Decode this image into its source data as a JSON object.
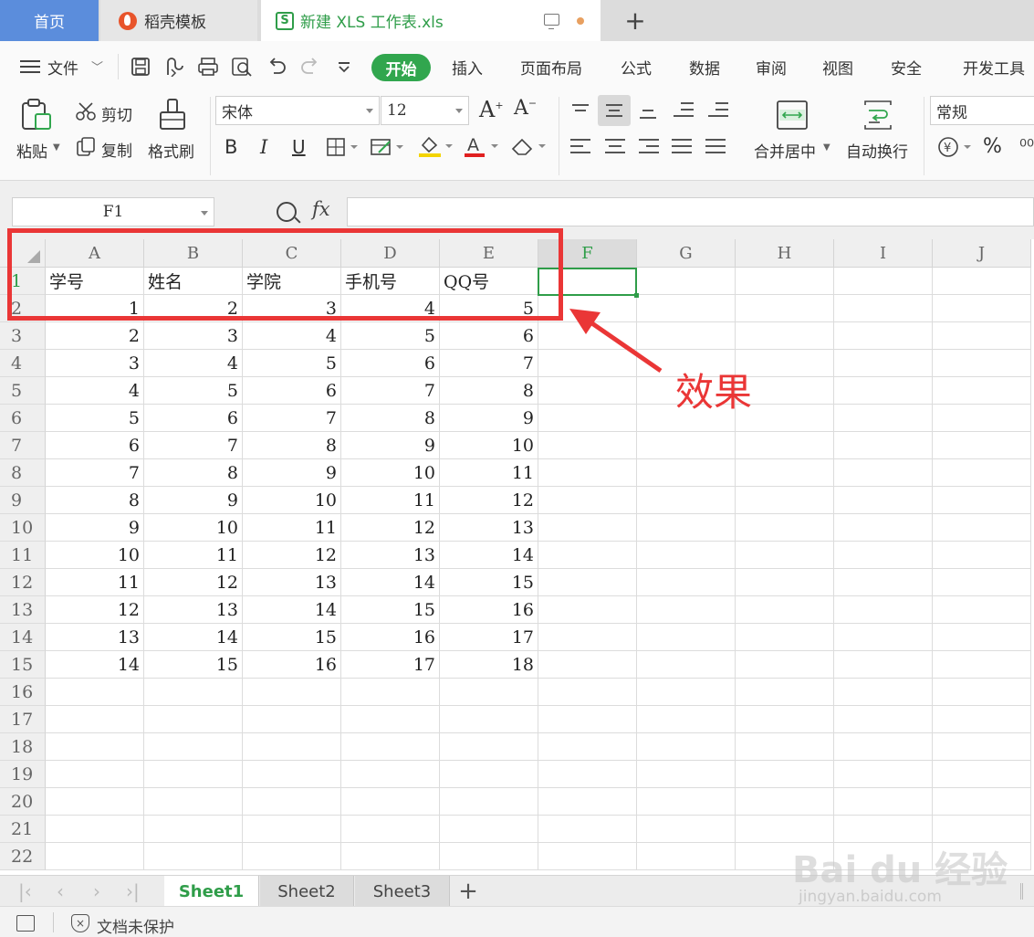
{
  "tabs": {
    "home": "首页",
    "daoke": "稻壳模板",
    "file": "新建 XLS 工作表.xls",
    "file_logo": "S"
  },
  "menu": {
    "file": "文件",
    "items": [
      "开始",
      "插入",
      "页面布局",
      "公式",
      "数据",
      "审阅",
      "视图",
      "安全",
      "开发工具"
    ]
  },
  "ribbon": {
    "paste": "粘贴",
    "cut": "剪切",
    "copy": "复制",
    "format_painter": "格式刷",
    "font_name": "宋体",
    "font_size": "12",
    "bold": "B",
    "italic": "I",
    "underline": "U",
    "merge_center": "合并居中",
    "wrap_text": "自动换行",
    "number_format": "常规",
    "percent": "%"
  },
  "formula_bar": {
    "name_box": "F1",
    "fx": "fx",
    "formula": ""
  },
  "grid": {
    "columns": [
      "A",
      "B",
      "C",
      "D",
      "E",
      "F",
      "G",
      "H",
      "I",
      "J"
    ],
    "active_column": "F",
    "active_row": "1",
    "row_numbers": [
      "1",
      "2",
      "3",
      "4",
      "5",
      "6",
      "7",
      "8",
      "9",
      "10",
      "11",
      "12",
      "13",
      "14",
      "15",
      "16",
      "17",
      "18",
      "19",
      "20",
      "21",
      "22"
    ],
    "header_row": [
      "学号",
      "姓名",
      "学院",
      "手机号",
      "QQ号"
    ],
    "rows": [
      [
        "1",
        "2",
        "3",
        "4",
        "5"
      ],
      [
        "2",
        "3",
        "4",
        "5",
        "6"
      ],
      [
        "3",
        "4",
        "5",
        "6",
        "7"
      ],
      [
        "4",
        "5",
        "6",
        "7",
        "8"
      ],
      [
        "5",
        "6",
        "7",
        "8",
        "9"
      ],
      [
        "6",
        "7",
        "8",
        "9",
        "10"
      ],
      [
        "7",
        "8",
        "9",
        "10",
        "11"
      ],
      [
        "8",
        "9",
        "10",
        "11",
        "12"
      ],
      [
        "9",
        "10",
        "11",
        "12",
        "13"
      ],
      [
        "10",
        "11",
        "12",
        "13",
        "14"
      ],
      [
        "11",
        "12",
        "13",
        "14",
        "15"
      ],
      [
        "12",
        "13",
        "14",
        "15",
        "16"
      ],
      [
        "13",
        "14",
        "15",
        "16",
        "17"
      ],
      [
        "14",
        "15",
        "16",
        "17",
        "18"
      ]
    ]
  },
  "annotation": {
    "label": "效果",
    "color": "#ea3636"
  },
  "sheets": {
    "tabs": [
      "Sheet1",
      "Sheet2",
      "Sheet3"
    ],
    "active": "Sheet1",
    "add": "+"
  },
  "status": {
    "protection": "文档未保护"
  },
  "watermark": {
    "brand": "Bai du 经验",
    "url": "jingyan.baidu.com"
  },
  "colors": {
    "accent_green": "#31a64e",
    "home_tab": "#5b8ddc",
    "annotation_red": "#ea3636"
  }
}
